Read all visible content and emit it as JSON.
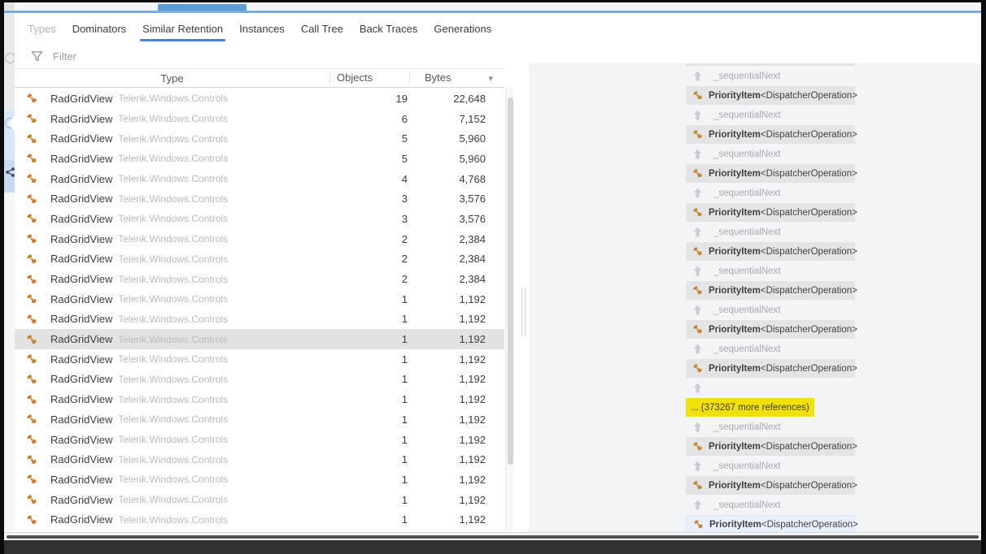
{
  "tabs": [
    {
      "label": "Types",
      "state": "disabled"
    },
    {
      "label": "Dominators",
      "state": "normal"
    },
    {
      "label": "Similar Retention",
      "state": "active"
    },
    {
      "label": "Instances",
      "state": "normal"
    },
    {
      "label": "Call Tree",
      "state": "normal"
    },
    {
      "label": "Back Traces",
      "state": "normal"
    },
    {
      "label": "Generations",
      "state": "normal"
    }
  ],
  "filter": {
    "placeholder": "Filter"
  },
  "icons": {
    "bytes_dropdown": "▾"
  },
  "table": {
    "columns": [
      {
        "label": "Type"
      },
      {
        "label": "Objects"
      },
      {
        "label": "Bytes",
        "has_dropdown": true
      }
    ],
    "rows": [
      {
        "type": "RadGridView",
        "namespace": "Telerik.Windows.Controls",
        "objects": "19",
        "bytes": "22,648",
        "selected": false
      },
      {
        "type": "RadGridView",
        "namespace": "Telerik.Windows.Controls",
        "objects": "6",
        "bytes": "7,152",
        "selected": false
      },
      {
        "type": "RadGridView",
        "namespace": "Telerik.Windows.Controls",
        "objects": "5",
        "bytes": "5,960",
        "selected": false
      },
      {
        "type": "RadGridView",
        "namespace": "Telerik.Windows.Controls",
        "objects": "5",
        "bytes": "5,960",
        "selected": false
      },
      {
        "type": "RadGridView",
        "namespace": "Telerik.Windows.Controls",
        "objects": "4",
        "bytes": "4,768",
        "selected": false
      },
      {
        "type": "RadGridView",
        "namespace": "Telerik.Windows.Controls",
        "objects": "3",
        "bytes": "3,576",
        "selected": false
      },
      {
        "type": "RadGridView",
        "namespace": "Telerik.Windows.Controls",
        "objects": "3",
        "bytes": "3,576",
        "selected": false
      },
      {
        "type": "RadGridView",
        "namespace": "Telerik.Windows.Controls",
        "objects": "2",
        "bytes": "2,384",
        "selected": false
      },
      {
        "type": "RadGridView",
        "namespace": "Telerik.Windows.Controls",
        "objects": "2",
        "bytes": "2,384",
        "selected": false
      },
      {
        "type": "RadGridView",
        "namespace": "Telerik.Windows.Controls",
        "objects": "2",
        "bytes": "2,384",
        "selected": false
      },
      {
        "type": "RadGridView",
        "namespace": "Telerik.Windows.Controls",
        "objects": "1",
        "bytes": "1,192",
        "selected": false
      },
      {
        "type": "RadGridView",
        "namespace": "Telerik.Windows.Controls",
        "objects": "1",
        "bytes": "1,192",
        "selected": false
      },
      {
        "type": "RadGridView",
        "namespace": "Telerik.Windows.Controls",
        "objects": "1",
        "bytes": "1,192",
        "selected": true
      },
      {
        "type": "RadGridView",
        "namespace": "Telerik.Windows.Controls",
        "objects": "1",
        "bytes": "1,192",
        "selected": false
      },
      {
        "type": "RadGridView",
        "namespace": "Telerik.Windows.Controls",
        "objects": "1",
        "bytes": "1,192",
        "selected": false
      },
      {
        "type": "RadGridView",
        "namespace": "Telerik.Windows.Controls",
        "objects": "1",
        "bytes": "1,192",
        "selected": false
      },
      {
        "type": "RadGridView",
        "namespace": "Telerik.Windows.Controls",
        "objects": "1",
        "bytes": "1,192",
        "selected": false
      },
      {
        "type": "RadGridView",
        "namespace": "Telerik.Windows.Controls",
        "objects": "1",
        "bytes": "1,192",
        "selected": false
      },
      {
        "type": "RadGridView",
        "namespace": "Telerik.Windows.Controls",
        "objects": "1",
        "bytes": "1,192",
        "selected": false
      },
      {
        "type": "RadGridView",
        "namespace": "Telerik.Windows.Controls",
        "objects": "1",
        "bytes": "1,192",
        "selected": false
      },
      {
        "type": "RadGridView",
        "namespace": "Telerik.Windows.Controls",
        "objects": "1",
        "bytes": "1,192",
        "selected": false
      },
      {
        "type": "RadGridView",
        "namespace": "Telerik.Windows.Controls",
        "objects": "1",
        "bytes": "1,192",
        "selected": false
      }
    ]
  },
  "retention_chain": {
    "edge_label": "_sequentialNext",
    "node": {
      "name": "PriorityItem",
      "generic": "<DispatcherOperation>"
    },
    "more_label": "... (373267 more references)",
    "items": [
      {
        "type": "node_partial"
      },
      {
        "type": "edge"
      },
      {
        "type": "node"
      },
      {
        "type": "edge"
      },
      {
        "type": "node"
      },
      {
        "type": "edge"
      },
      {
        "type": "node"
      },
      {
        "type": "edge"
      },
      {
        "type": "node"
      },
      {
        "type": "edge"
      },
      {
        "type": "node"
      },
      {
        "type": "edge"
      },
      {
        "type": "node"
      },
      {
        "type": "edge"
      },
      {
        "type": "node"
      },
      {
        "type": "edge"
      },
      {
        "type": "node"
      },
      {
        "type": "edge",
        "no_label": true
      },
      {
        "type": "more"
      },
      {
        "type": "edge"
      },
      {
        "type": "node"
      },
      {
        "type": "edge"
      },
      {
        "type": "node"
      },
      {
        "type": "edge"
      },
      {
        "type": "node",
        "selected": true
      }
    ]
  },
  "colors": {
    "accent_blue": "#4a7ed8",
    "top_blue": "#5c9cd8",
    "highlight_yellow": "#f1e106",
    "icon_orange": "#c8802c",
    "row_selected": "#e2e2e2",
    "node_selected": "#e9effc"
  }
}
